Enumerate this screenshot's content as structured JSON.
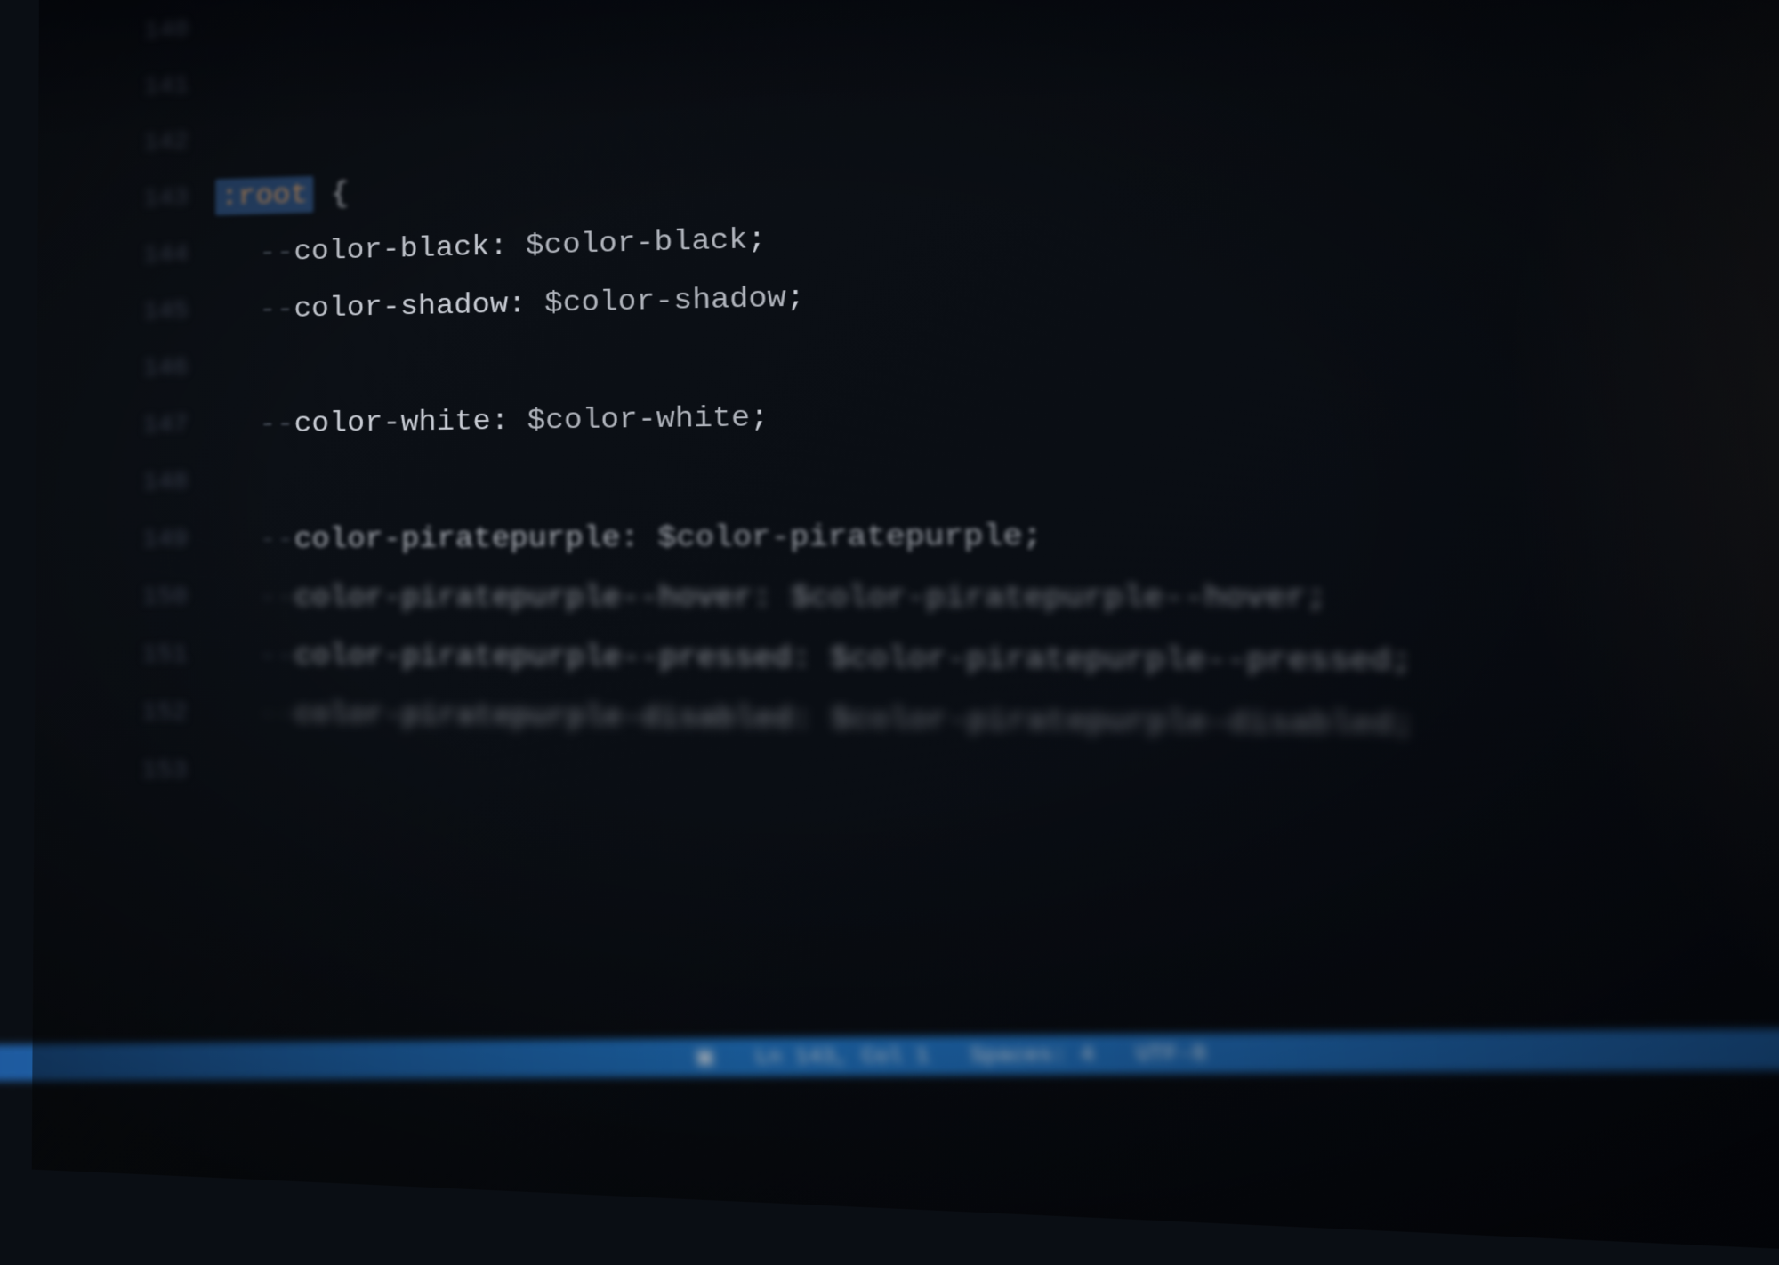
{
  "editor": {
    "gutter": {
      "lines": [
        "140",
        "141",
        "142",
        "143",
        "144",
        "145",
        "146",
        "147",
        "148",
        "149",
        "150",
        "151",
        "152",
        "153"
      ]
    },
    "code": {
      "selector": ":root",
      "brace_open": "{",
      "lines": [
        {
          "dash": "--",
          "name": "color-black",
          "colon": ":",
          "value": "$color-black",
          "semi": ";",
          "blur": "light"
        },
        {
          "dash": "--",
          "name": "color-shadow",
          "colon": ":",
          "value": "$color-shadow",
          "semi": ";",
          "blur": "light"
        },
        {
          "empty": true
        },
        {
          "dash": "--",
          "name": "color-white",
          "colon": ":",
          "value": "$color-white",
          "semi": ";",
          "blur": "light"
        },
        {
          "empty": true
        },
        {
          "dash": "--",
          "name": "color-piratepurple",
          "colon": ":",
          "value": "$color-piratepurple",
          "semi": ";",
          "blur": "med"
        },
        {
          "dash": "--",
          "name": "color-piratepurple--hover",
          "colon": ":",
          "value": "$color-piratepurple--hover",
          "semi": ";",
          "blur": "heavy"
        },
        {
          "dash": "--",
          "name": "color-piratepurple--pressed",
          "colon": ":",
          "value": "$color-piratepurple--pressed",
          "semi": ";",
          "blur": "heavy"
        },
        {
          "dash": "--",
          "name": "color-piratepurple-disabled",
          "colon": ":",
          "value": "$color-piratepurple-disabled",
          "semi": ";",
          "blur": "xheavy"
        }
      ]
    }
  },
  "status_bar": {
    "cursor": "Ln 143, Col 1",
    "spaces": "Spaces: 4",
    "encoding": "UTF-8"
  }
}
